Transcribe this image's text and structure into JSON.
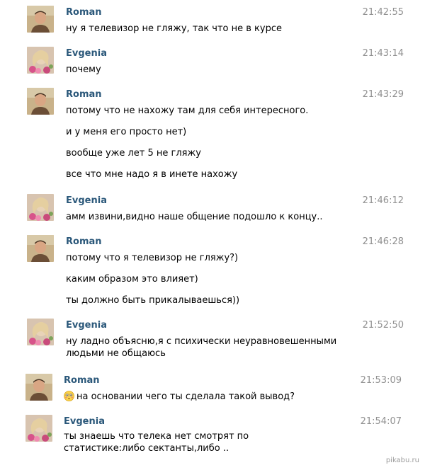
{
  "messages": [
    {
      "author": "Roman",
      "avatar": "roman-avatar",
      "time": "21:42:55",
      "lines": [
        "ну я телевизор не гляжу, так что не в курсе"
      ]
    },
    {
      "author": "Evgenia",
      "avatar": "evgenia-avatar",
      "time": "21:43:14",
      "lines": [
        "почему"
      ]
    },
    {
      "author": "Roman",
      "avatar": "roman-avatar",
      "time": "21:43:29",
      "lines": [
        "потому что не нахожу там для себя интересного.",
        "и у меня его просто нет)",
        "вообще уже лет 5 не гляжу",
        "все что мне надо я в инете нахожу"
      ]
    },
    {
      "author": "Evgenia",
      "avatar": "evgenia-avatar",
      "time": "21:46:12",
      "lines": [
        "амм извини,видно наше общение подошло к концу.."
      ]
    },
    {
      "author": "Roman",
      "avatar": "roman-avatar",
      "time": "21:46:28",
      "lines": [
        "потому что я телевизор не гляжу?)",
        "каким образом это влияет)",
        "ты должно быть прикалываешься))"
      ]
    },
    {
      "author": "Evgenia",
      "avatar": "evgenia-avatar",
      "time": "21:52:50",
      "lines": [
        "ну ладно объясню,я с психически неуравновешенными людьми не общаюсь"
      ]
    },
    {
      "author": "Roman",
      "avatar": "roman-avatar",
      "time": "21:53:09",
      "lines": [
        "на основании чего ты сделала такой вывод?"
      ],
      "emoji": "flushed-face-icon"
    },
    {
      "author": "Evgenia",
      "avatar": "evgenia-avatar",
      "time": "21:54:07",
      "lines": [
        "ты знаешь что телека нет смотрят по статистике:либо сектанты,либо .."
      ]
    }
  ],
  "watermark": "pikabu.ru",
  "colors": {
    "author": "#2b587a",
    "time": "#909090",
    "text": "#000000"
  }
}
